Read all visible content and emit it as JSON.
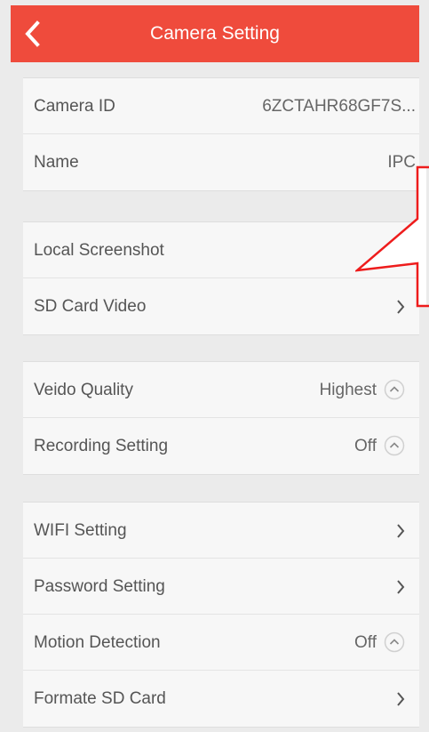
{
  "header": {
    "title": "Camera Setting",
    "back_icon": "chevron-left-icon"
  },
  "colors": {
    "header_bg": "#ef4b3c",
    "accent_callout": "#ee1c1c"
  },
  "groups": [
    {
      "rows": [
        {
          "label": "Camera ID",
          "value": "6ZCTAHR68GF7S..."
        },
        {
          "label": "Name",
          "value": "IPC"
        }
      ]
    },
    {
      "rows": [
        {
          "label": "Local Screenshot",
          "value": "",
          "icon": "chevron-right-icon"
        },
        {
          "label": "SD Card Video",
          "value": "",
          "icon": "chevron-right-icon"
        }
      ]
    },
    {
      "rows": [
        {
          "label": "Veido Quality",
          "value": "Highest",
          "icon": "chevron-up-circle-icon"
        },
        {
          "label": "Recording Setting",
          "value": "Off",
          "icon": "chevron-up-circle-icon"
        }
      ]
    },
    {
      "rows": [
        {
          "label": "WIFI Setting",
          "value": "",
          "icon": "chevron-right-icon"
        },
        {
          "label": "Password Setting",
          "value": "",
          "icon": "chevron-right-icon"
        },
        {
          "label": "Motion Detection",
          "value": "Off",
          "icon": "chevron-up-circle-icon"
        },
        {
          "label": "Formate SD Card",
          "value": "",
          "icon": "chevron-right-icon"
        }
      ]
    }
  ]
}
